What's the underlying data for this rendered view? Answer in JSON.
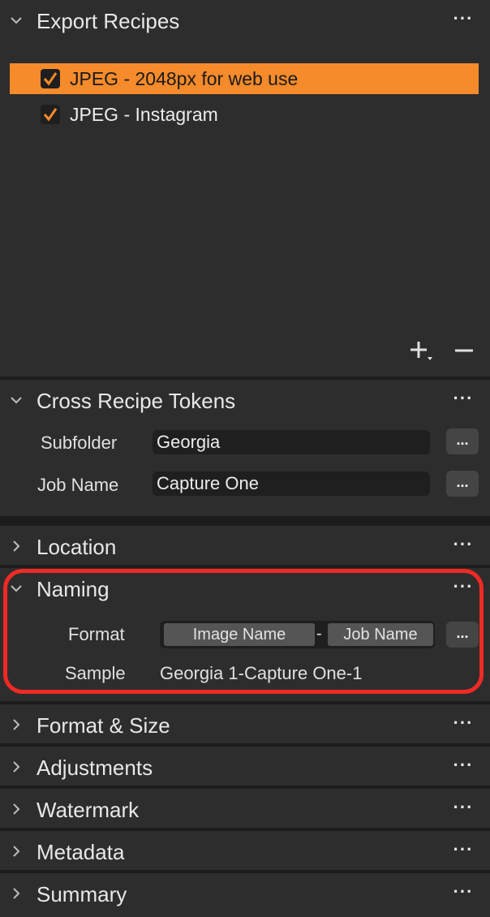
{
  "export_recipes": {
    "title": "Export Recipes",
    "items": [
      {
        "label": "JPEG - 2048px for web use",
        "checked": true,
        "selected": true
      },
      {
        "label": "JPEG - Instagram",
        "checked": true,
        "selected": false
      }
    ]
  },
  "cross_recipe_tokens": {
    "title": "Cross Recipe Tokens",
    "subfolder_label": "Subfolder",
    "subfolder_value": "Georgia",
    "job_name_label": "Job Name",
    "job_name_value": "Capture One",
    "more_label": "..."
  },
  "location": {
    "title": "Location"
  },
  "naming": {
    "title": "Naming",
    "format_label": "Format",
    "tokens": [
      "Image Name",
      "-",
      "Job Name"
    ],
    "sample_label": "Sample",
    "sample_value": "Georgia 1-Capture One-1",
    "more_label": "..."
  },
  "sections": [
    {
      "title": "Format & Size"
    },
    {
      "title": "Adjustments"
    },
    {
      "title": "Watermark"
    },
    {
      "title": "Metadata"
    },
    {
      "title": "Summary"
    }
  ],
  "menu_dots": "···",
  "colors": {
    "accent": "#f58b2b",
    "highlight_border": "#ef2a25",
    "panel": "#2d2d2d",
    "background": "#1c1c1c"
  },
  "icons": {
    "expanded": "chevron-down-icon",
    "collapsed": "chevron-right-icon",
    "checkbox": "checkmark-icon",
    "add": "plus-icon",
    "remove": "minus-icon"
  }
}
